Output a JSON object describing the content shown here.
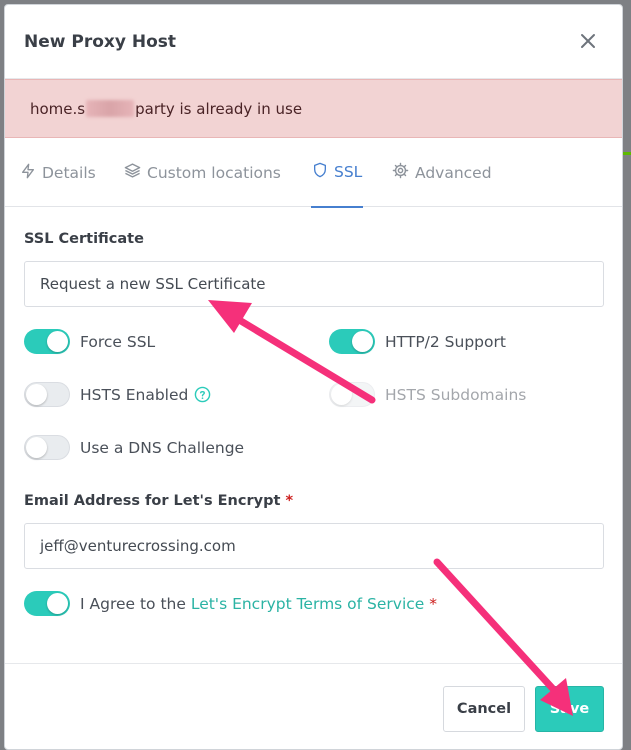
{
  "modal": {
    "title": "New Proxy Host",
    "close_icon": "close-icon"
  },
  "alert": {
    "text_start": "home.s",
    "text_end": "party is already in use",
    "color": "#f2d3d3"
  },
  "tabs": [
    {
      "label": "Details",
      "icon": "bolt-icon",
      "active": false
    },
    {
      "label": "Custom locations",
      "icon": "layers-icon",
      "active": false
    },
    {
      "label": "SSL",
      "icon": "shield-icon",
      "active": true
    },
    {
      "label": "Advanced",
      "icon": "gear-icon",
      "active": false
    }
  ],
  "ssl": {
    "certificate_label": "SSL Certificate",
    "certificate_value": "Request a new SSL Certificate",
    "toggles": {
      "force_ssl": {
        "label": "Force SSL",
        "on": true
      },
      "http2": {
        "label": "HTTP/2 Support",
        "on": true
      },
      "hsts_enabled": {
        "label": "HSTS Enabled",
        "on": false
      },
      "hsts_subdomains": {
        "label": "HSTS Subdomains",
        "on": false,
        "disabled": true
      },
      "dns_challenge": {
        "label": "Use a DNS Challenge",
        "on": false
      }
    },
    "email_label": "Email Address for Let's Encrypt",
    "required_mark": "*",
    "email_value": "jeff@venturecrossing.com",
    "agree_text": "I Agree to the ",
    "agree_link": "Let's Encrypt Terms of Service",
    "agree_on": true
  },
  "footer": {
    "cancel_label": "Cancel",
    "save_label": "Save"
  },
  "colors": {
    "accent": "#2bcbba",
    "active_tab": "#467fcf",
    "annotation_arrow": "#f5307a"
  }
}
